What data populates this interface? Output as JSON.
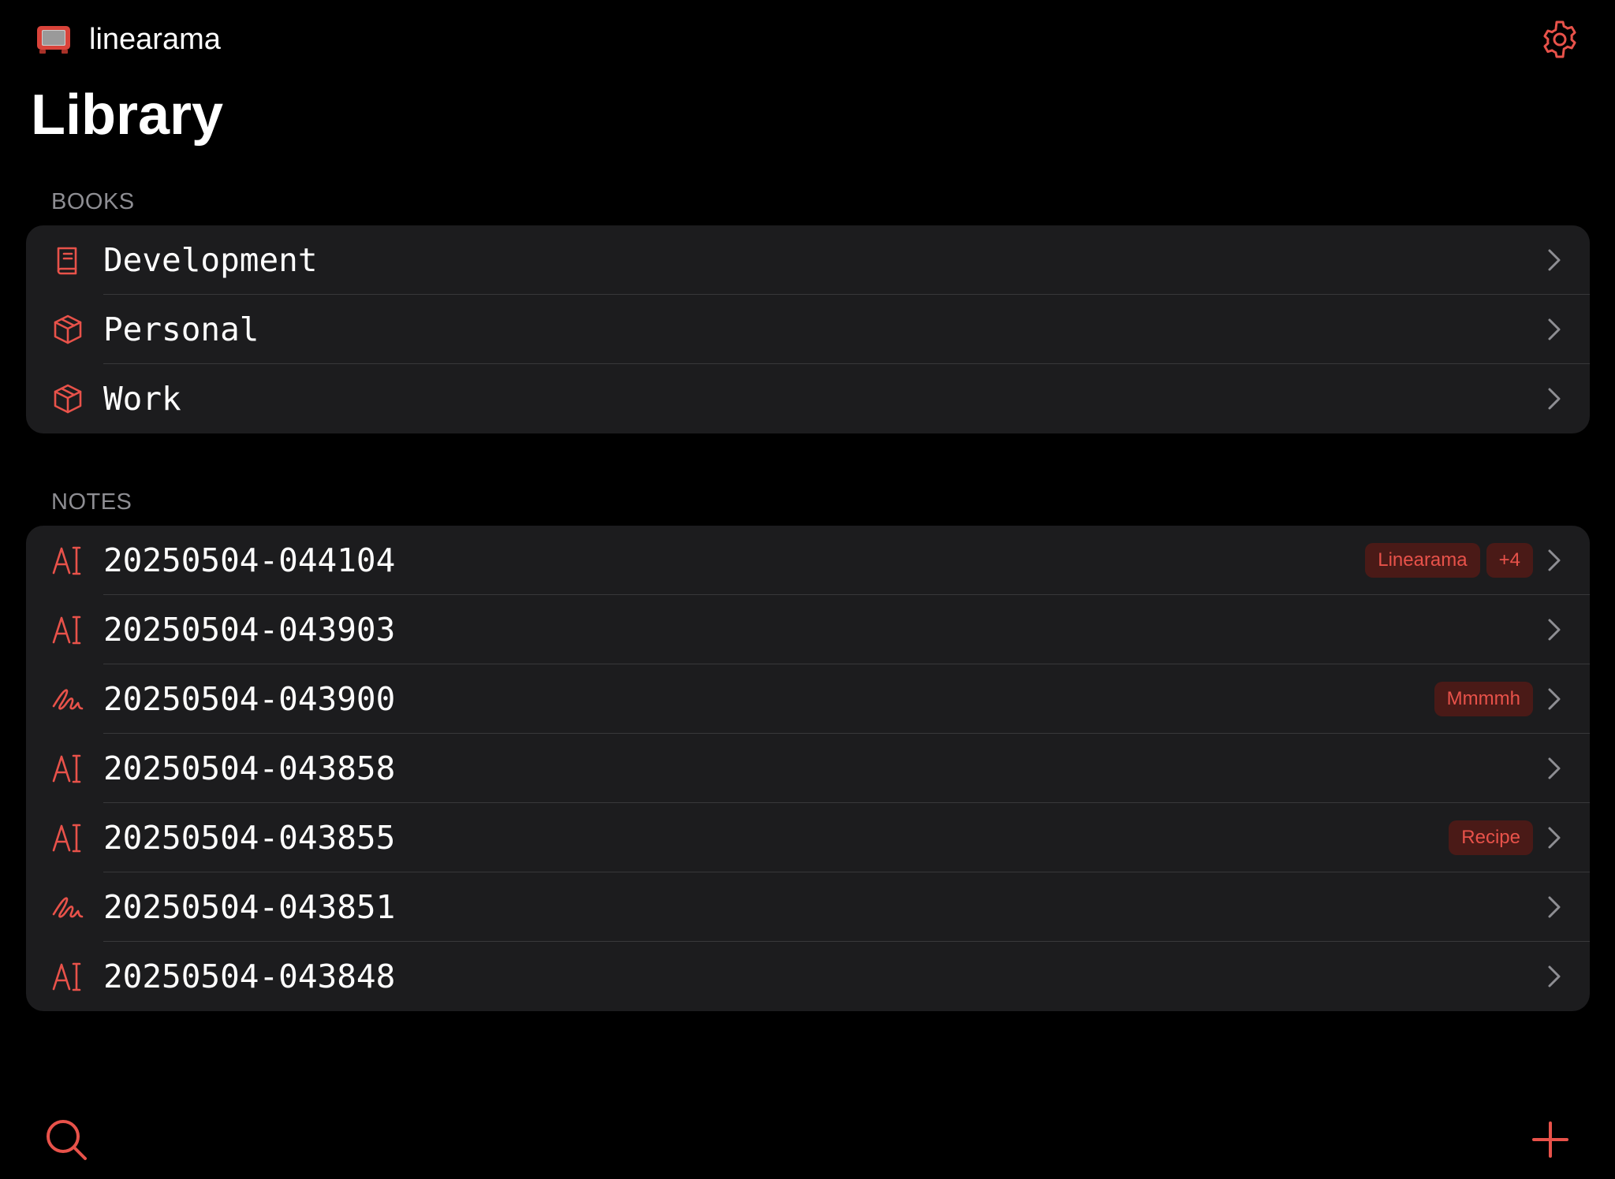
{
  "app": {
    "name": "linearama",
    "logo_icon": "monitor-logo-icon",
    "settings_icon": "gear-icon"
  },
  "page": {
    "title": "Library"
  },
  "theme": {
    "accent": "#e8524a",
    "background": "#000000",
    "group_background": "#1c1c1e",
    "tag_background": "#4a1a17",
    "section_header": "#8e8e93",
    "chevron": "#8e8e93"
  },
  "books": {
    "header": "BOOKS",
    "items": [
      {
        "label": "Development",
        "icon": "book-icon"
      },
      {
        "label": "Personal",
        "icon": "box-icon"
      },
      {
        "label": "Work",
        "icon": "box-icon"
      }
    ]
  },
  "notes": {
    "header": "NOTES",
    "items": [
      {
        "label": "20250504-044104",
        "icon": "text-cursor-icon",
        "tags": [
          "Linearama",
          "+4"
        ]
      },
      {
        "label": "20250504-043903",
        "icon": "text-cursor-icon",
        "tags": []
      },
      {
        "label": "20250504-043900",
        "icon": "scribble-icon",
        "tags": [
          "Mmmmh"
        ]
      },
      {
        "label": "20250504-043858",
        "icon": "text-cursor-icon",
        "tags": []
      },
      {
        "label": "20250504-043855",
        "icon": "text-cursor-icon",
        "tags": [
          "Recipe"
        ]
      },
      {
        "label": "20250504-043851",
        "icon": "scribble-icon",
        "tags": []
      },
      {
        "label": "20250504-043848",
        "icon": "text-cursor-icon",
        "tags": []
      }
    ]
  },
  "toolbar": {
    "search_icon": "search-icon",
    "add_icon": "plus-icon"
  }
}
